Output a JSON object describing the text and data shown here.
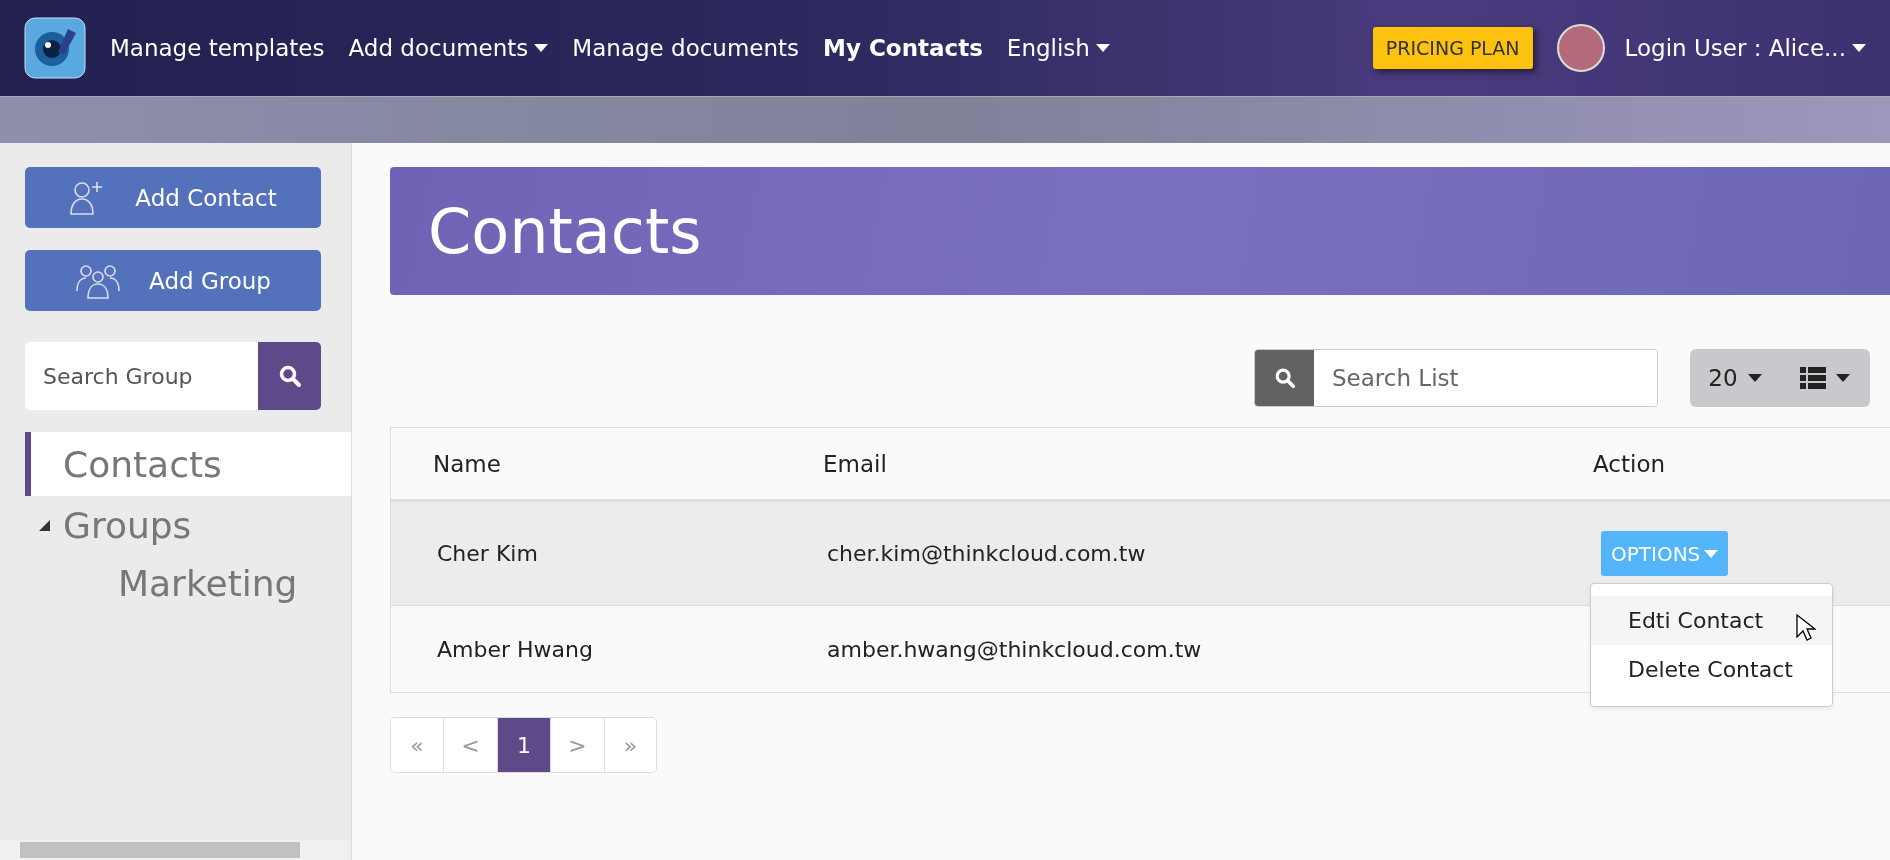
{
  "navbar": {
    "items": [
      {
        "label": "Manage templates",
        "selected": false,
        "dropdown": false
      },
      {
        "label": "Add documents",
        "selected": false,
        "dropdown": true
      },
      {
        "label": "Manage documents",
        "selected": false,
        "dropdown": false
      },
      {
        "label": "My Contacts",
        "selected": true,
        "dropdown": false
      },
      {
        "label": "English",
        "selected": false,
        "dropdown": true
      }
    ],
    "pricing_button": "PRICING PLAN",
    "user_label": "Login User : Alice..."
  },
  "sidebar": {
    "buttons": [
      {
        "label": "Add Contact",
        "kind": "contact"
      },
      {
        "label": "Add Group",
        "kind": "group"
      }
    ],
    "search": {
      "placeholder": "Search Group"
    },
    "tree": [
      {
        "label": "Contacts",
        "selected": true
      },
      {
        "label": "Groups",
        "selected": false,
        "expanded": true,
        "children": [
          {
            "label": "Marketing",
            "selected": false
          }
        ]
      }
    ]
  },
  "banner": {
    "title": "Contacts"
  },
  "toolbar": {
    "search": {
      "placeholder": "Search List"
    },
    "page_size": "20"
  },
  "table": {
    "columns": [
      "Name",
      "Email",
      "Action"
    ],
    "rows": [
      {
        "name": "Cher Kim",
        "email": "cher.kim@thinkcloud.com.tw",
        "action": "OPTIONS",
        "highlighted": true
      },
      {
        "name": "Amber Hwang",
        "email": "amber.hwang@thinkcloud.com.tw",
        "action": "",
        "highlighted": false
      }
    ]
  },
  "options_menu": {
    "items": [
      {
        "label": "Edti Contact",
        "highlighted": true
      },
      {
        "label": "Delete Contact",
        "highlighted": false
      }
    ]
  },
  "pagination": [
    {
      "label": "«",
      "selected": false
    },
    {
      "label": "<",
      "selected": false
    },
    {
      "label": "1",
      "selected": true
    },
    {
      "label": ">",
      "selected": false
    },
    {
      "label": "»",
      "selected": false
    }
  ]
}
